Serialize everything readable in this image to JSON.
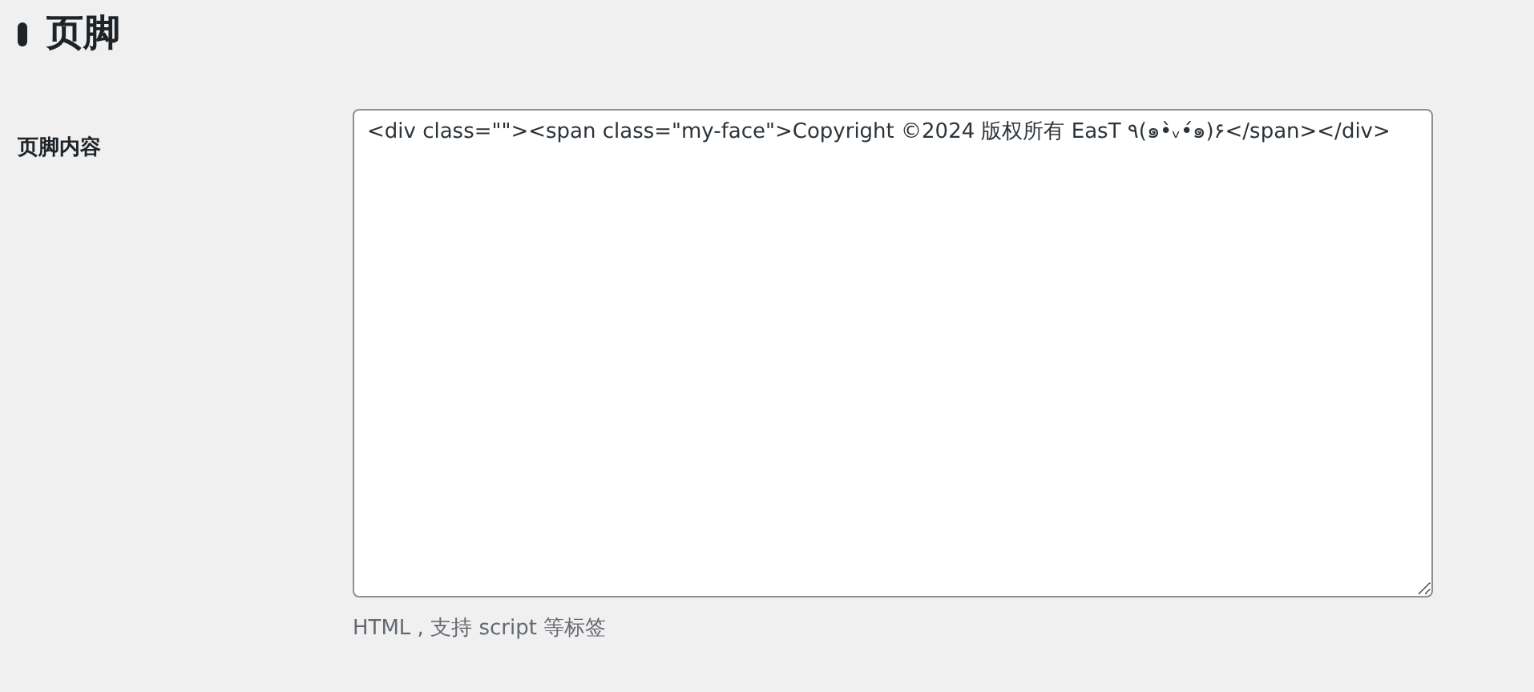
{
  "section": {
    "title": "页脚"
  },
  "fields": [
    {
      "label": "页脚内容",
      "value": "<div class=\"\"><span class=\"my-face\">Copyright ©2024 版权所有 EasT ٩(๑•̀ᵥ•́๑)۶</span></div>",
      "description": "HTML , 支持 script 等标签"
    }
  ]
}
